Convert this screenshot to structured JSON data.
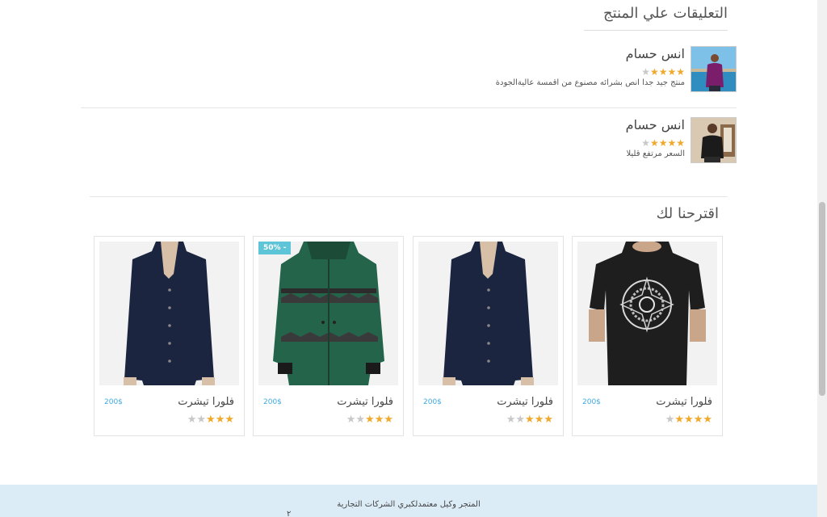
{
  "comments": {
    "title": "التعليقات علي المنتج",
    "items": [
      {
        "name": "انس حسام",
        "rating": 4,
        "text": "منتج جيد جدا انص بشرائه مصنوع من اقمسة عاليةالجودة"
      },
      {
        "name": "انس حسام",
        "rating": 4,
        "text": "السعر مرتفع قليلا"
      }
    ]
  },
  "suggestions": {
    "title": "اقترحنا لك",
    "products": [
      {
        "title": "فلورا تيشرت",
        "price": "200$",
        "rating": 4,
        "image": "black-tshirt",
        "badge": ""
      },
      {
        "title": "فلورا تيشرت",
        "price": "200$",
        "rating": 3,
        "image": "navy-blouse",
        "badge": ""
      },
      {
        "title": "فلورا تيشرت",
        "price": "200$",
        "rating": 3,
        "image": "green-jacket",
        "badge": "50% -"
      },
      {
        "title": "فلورا تيشرت",
        "price": "200$",
        "rating": 3,
        "image": "navy-blouse",
        "badge": ""
      }
    ]
  },
  "footer": {
    "text": "المتجر وكيل معتمدلكبري الشركات التجارية",
    "mark": "٢"
  },
  "colors": {
    "star": "#f0a92c",
    "price": "#3fa9e0",
    "badge": "#5ec4d8",
    "footer_bg": "#dcecf7"
  }
}
